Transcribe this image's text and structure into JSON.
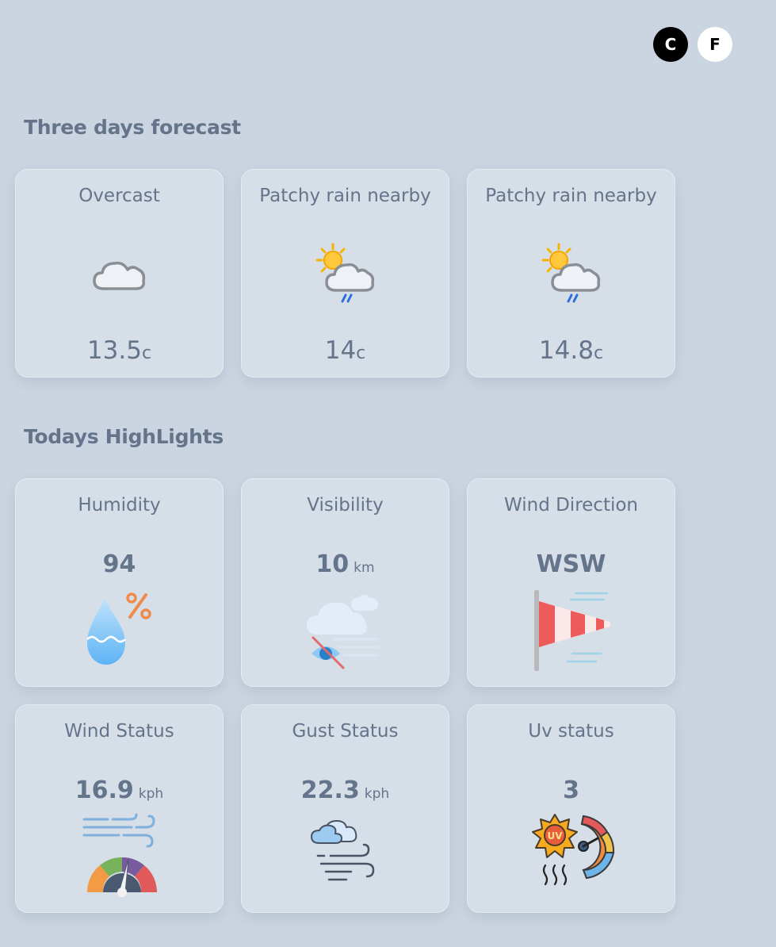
{
  "units": {
    "celsius_label": "C",
    "fahrenheit_label": "F",
    "active": "C"
  },
  "forecast": {
    "title": "Three days forecast",
    "days": [
      {
        "condition": "Overcast",
        "temp": "13.5",
        "unit": "c",
        "icon": "cloud-icon"
      },
      {
        "condition": "Patchy rain nearby",
        "temp": "14",
        "unit": "c",
        "icon": "sun-cloud-rain-icon"
      },
      {
        "condition": "Patchy rain nearby",
        "temp": "14.8",
        "unit": "c",
        "icon": "sun-cloud-rain-icon"
      }
    ]
  },
  "highlights": {
    "title": "Todays HighLights",
    "items": [
      {
        "label": "Humidity",
        "value": "94",
        "unit": "",
        "icon": "humidity-drop-icon"
      },
      {
        "label": "Visibility",
        "value": "10",
        "unit": "km",
        "icon": "visibility-fog-icon"
      },
      {
        "label": "Wind Direction",
        "value": "WSW",
        "unit": "",
        "icon": "windsock-icon"
      },
      {
        "label": "Wind Status",
        "value": "16.9",
        "unit": "kph",
        "icon": "wind-gauge-icon"
      },
      {
        "label": "Gust Status",
        "value": "22.3",
        "unit": "kph",
        "icon": "gust-cloud-icon"
      },
      {
        "label": "Uv status",
        "value": "3",
        "unit": "",
        "icon": "uv-meter-icon"
      }
    ]
  },
  "colors": {
    "background": "#cbd5e1",
    "card": "#d6dee7",
    "text": "#64748b",
    "active_unit": "#000000"
  }
}
